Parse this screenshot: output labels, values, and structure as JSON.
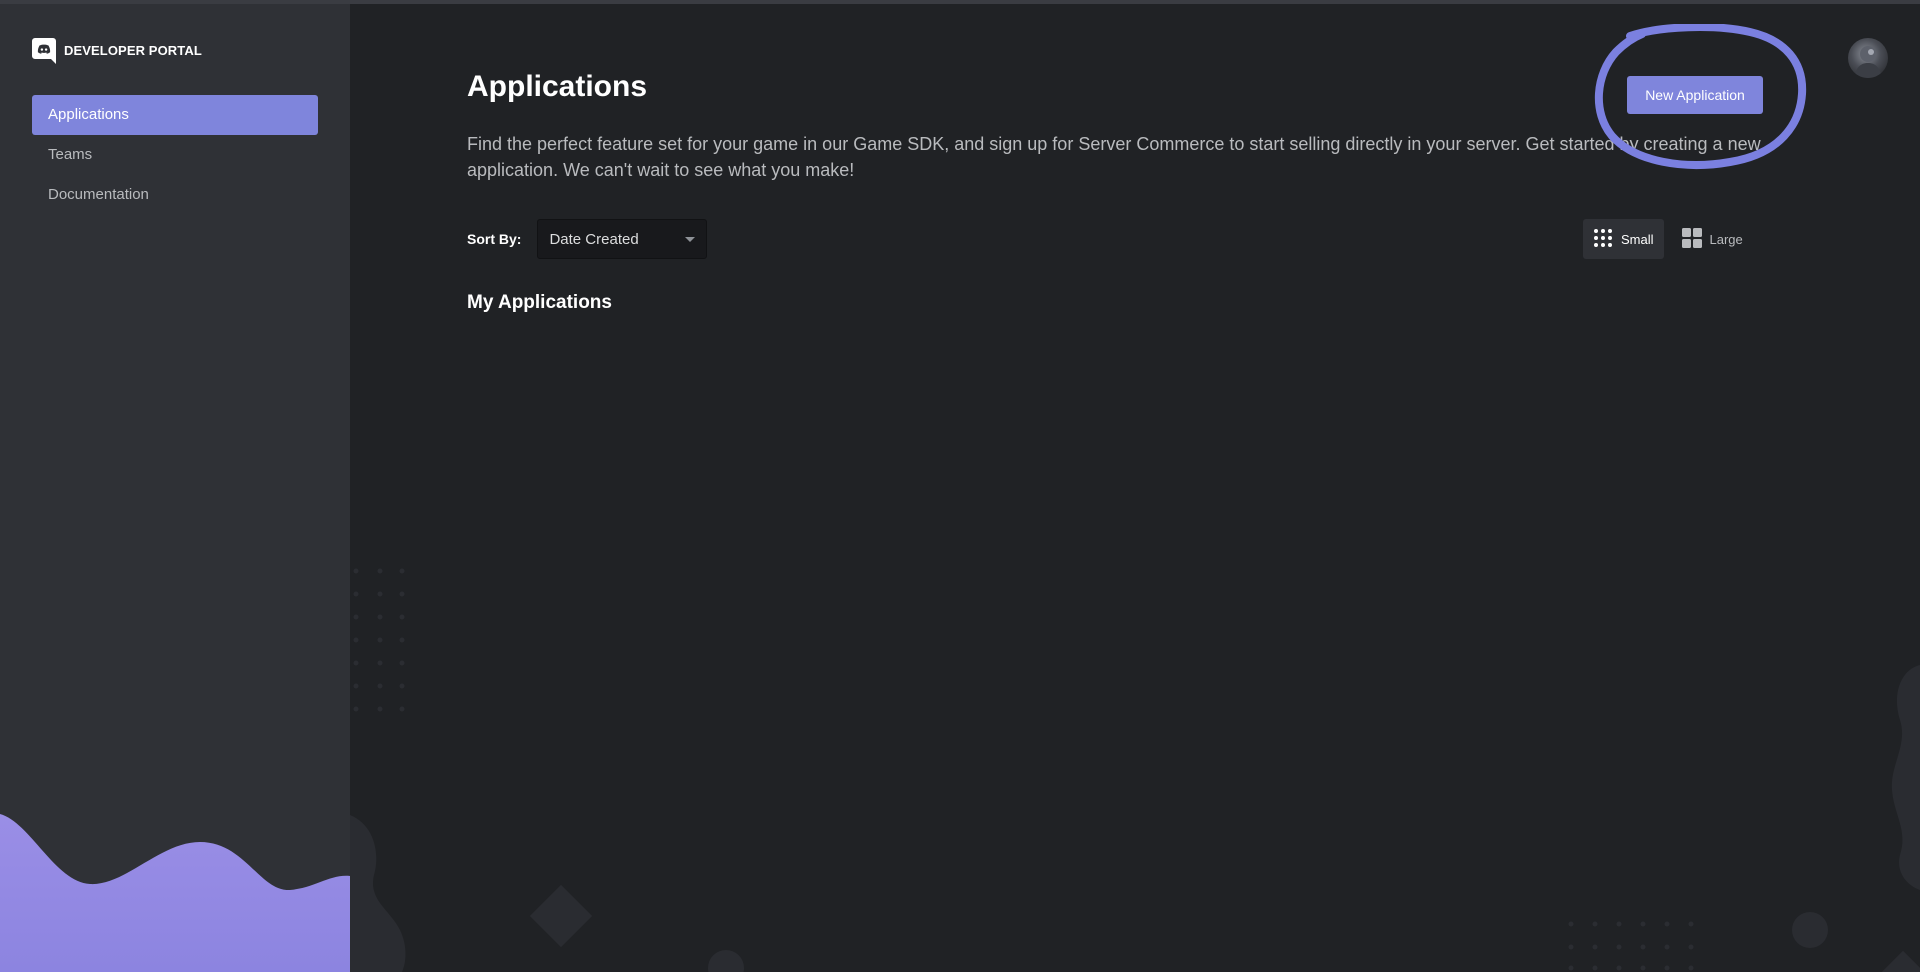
{
  "brand": {
    "title": "DEVELOPER PORTAL"
  },
  "sidebar": {
    "items": [
      {
        "label": "Applications",
        "active": true
      },
      {
        "label": "Teams",
        "active": false
      },
      {
        "label": "Documentation",
        "active": false
      }
    ]
  },
  "header": {
    "title": "Applications",
    "description": "Find the perfect feature set for your game in our Game SDK, and sign up for Server Commerce to start selling directly in your server. Get started by creating a new application. We can't wait to see what you make!",
    "new_app_label": "New Application"
  },
  "sort": {
    "label": "Sort By:",
    "selected": "Date Created"
  },
  "view": {
    "small_label": "Small",
    "large_label": "Large",
    "selected": "Small"
  },
  "section": {
    "title": "My Applications"
  },
  "colors": {
    "accent": "#7f85dc",
    "sidebar_bg": "#2f3136",
    "main_bg": "#202225",
    "highlight": "#7b80e0"
  },
  "icons": {
    "brand": "discord-logo-icon",
    "small_view": "dot-grid-icon",
    "large_view": "square-grid-icon",
    "caret": "chevron-down-icon"
  }
}
